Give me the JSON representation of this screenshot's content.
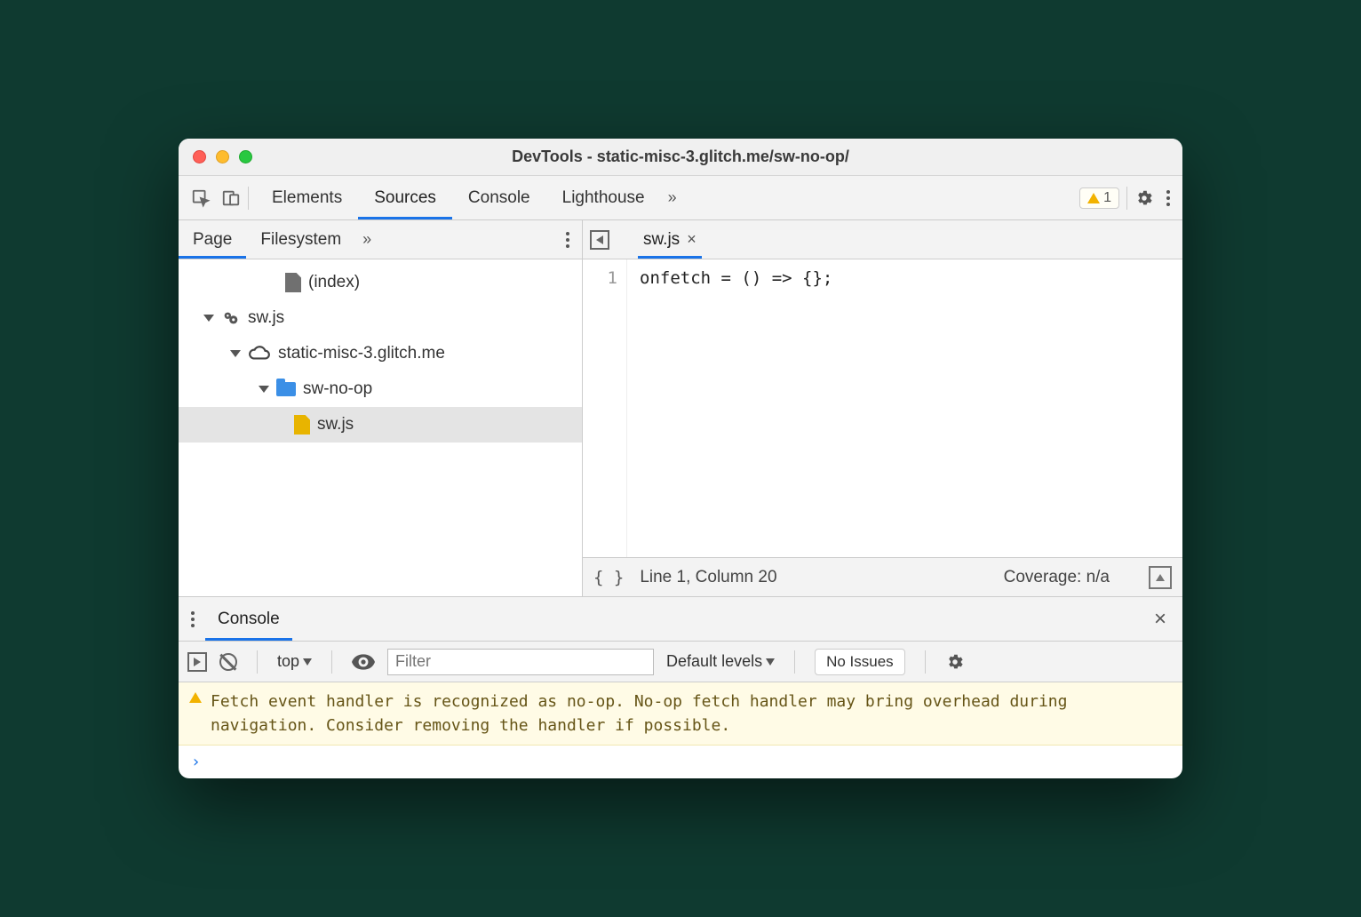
{
  "window": {
    "title": "DevTools - static-misc-3.glitch.me/sw-no-op/"
  },
  "maintabs": {
    "items": [
      "Elements",
      "Sources",
      "Console",
      "Lighthouse"
    ],
    "active": "Sources",
    "warning_count": "1"
  },
  "sources": {
    "subtabs": [
      "Page",
      "Filesystem"
    ],
    "active_subtab": "Page",
    "tree": {
      "index_label": "(index)",
      "sw_root": "sw.js",
      "host": "static-misc-3.glitch.me",
      "folder": "sw-no-op",
      "file": "sw.js"
    },
    "editor": {
      "open_file": "sw.js",
      "line_numbers": [
        "1"
      ],
      "code": "onfetch = () => {};",
      "status_pos": "Line 1, Column 20",
      "coverage": "Coverage: n/a"
    }
  },
  "drawer": {
    "tab": "Console"
  },
  "console_toolbar": {
    "context": "top",
    "filter_placeholder": "Filter",
    "levels": "Default levels",
    "issues": "No Issues"
  },
  "console": {
    "warning_text": "Fetch event handler is recognized as no-op. No-op fetch handler may bring overhead during navigation. Consider removing the handler if possible.",
    "prompt": "›"
  }
}
